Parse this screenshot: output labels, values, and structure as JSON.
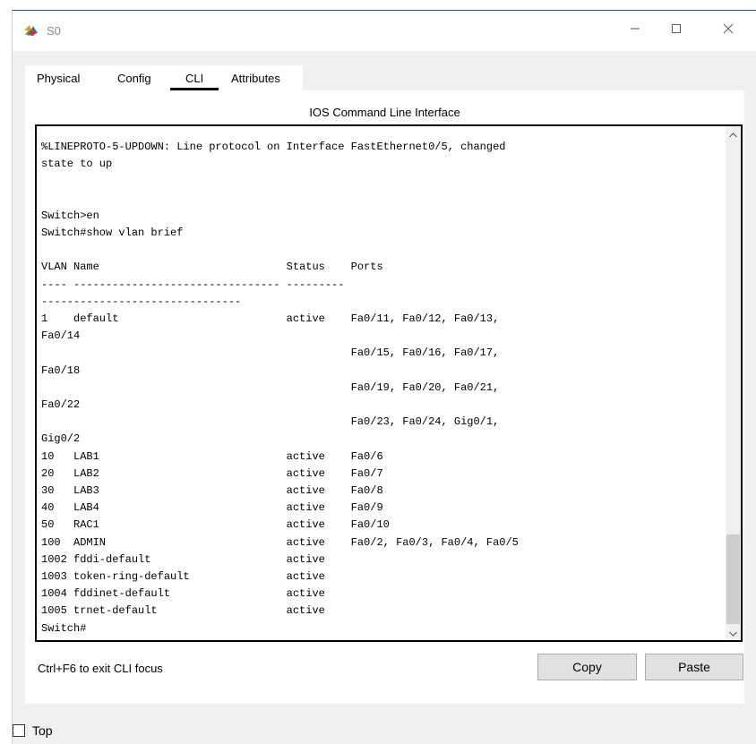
{
  "window": {
    "title": "S0",
    "app_icon": "packet-tracer-switch-icon",
    "controls": {
      "minimize": "minimize-icon",
      "maximize": "maximize-icon",
      "close": "close-icon"
    }
  },
  "tabs": [
    {
      "label": "Physical",
      "selected": false
    },
    {
      "label": "Config",
      "selected": false
    },
    {
      "label": "CLI",
      "selected": true
    },
    {
      "label": "Attributes",
      "selected": false
    }
  ],
  "panel": {
    "title": "IOS Command Line Interface"
  },
  "terminal": {
    "output": "%LINEPROTO-5-UPDOWN: Line protocol on Interface FastEthernet0/5, changed\nstate to up\n\n\nSwitch>en\nSwitch#show vlan brief\n\nVLAN Name                             Status    Ports\n---- -------------------------------- ---------\n-------------------------------\n1    default                          active    Fa0/11, Fa0/12, Fa0/13,\nFa0/14\n                                                Fa0/15, Fa0/16, Fa0/17,\nFa0/18\n                                                Fa0/19, Fa0/20, Fa0/21,\nFa0/22\n                                                Fa0/23, Fa0/24, Gig0/1,\nGig0/2\n10   LAB1                             active    Fa0/6\n20   LAB2                             active    Fa0/7\n30   LAB3                             active    Fa0/8\n40   LAB4                             active    Fa0/9\n50   RAC1                             active    Fa0/10\n100  ADMIN                            active    Fa0/2, Fa0/3, Fa0/4, Fa0/5\n1002 fddi-default                     active\n1003 token-ring-default               active\n1004 fddinet-default                  active\n1005 trnet-default                    active\nSwitch#",
    "scroll_icons": {
      "up": "chevron-up-icon",
      "down": "chevron-down-icon"
    }
  },
  "footer": {
    "hint": "Ctrl+F6 to exit CLI focus",
    "copy_label": "Copy",
    "paste_label": "Paste"
  },
  "bottom": {
    "top_label": "Top",
    "top_checked": false
  },
  "colors": {
    "title_bar_accent": "#2b4f7a",
    "client_background": "#f0f0f0",
    "button_background": "#e1e1e1"
  }
}
